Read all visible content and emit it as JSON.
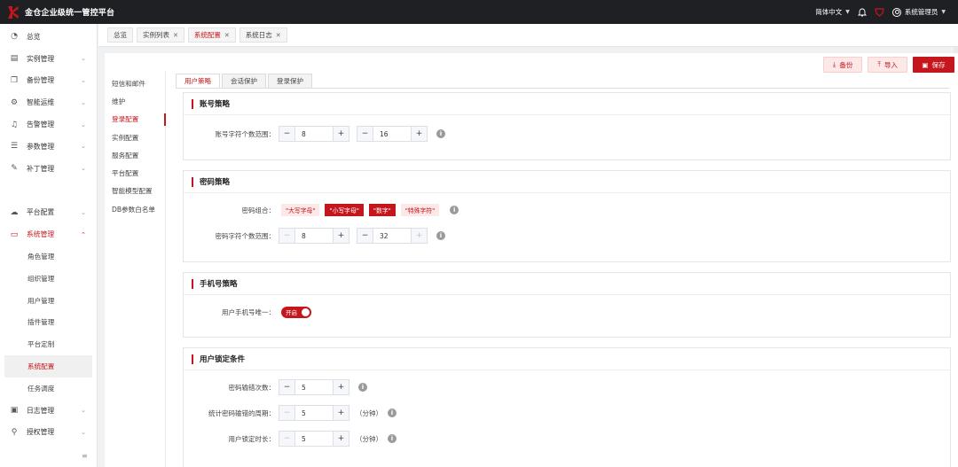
{
  "app": {
    "title": "金仓企业级统一管控平台"
  },
  "topbar": {
    "language": "简体中文",
    "user": "系统管理员"
  },
  "sidebar": {
    "items": [
      {
        "label": "总览",
        "icon": "dashboard-icon"
      },
      {
        "label": "实例管理",
        "icon": "list-icon"
      },
      {
        "label": "备份管理",
        "icon": "copy-icon"
      },
      {
        "label": "智能运维",
        "icon": "robot-icon"
      },
      {
        "label": "告警管理",
        "icon": "bell-icon"
      },
      {
        "label": "参数管理",
        "icon": "sliders-icon"
      },
      {
        "label": "补丁管理",
        "icon": "wrench-icon"
      }
    ],
    "items2": [
      {
        "label": "平台配置",
        "icon": "cloud-icon"
      },
      {
        "label": "系统管理",
        "icon": "monitor-icon"
      }
    ],
    "sub_items": [
      "角色管理",
      "组织管理",
      "用户管理",
      "插件管理",
      "平台定制",
      "系统配置",
      "任务调度"
    ],
    "items3": [
      {
        "label": "日志管理",
        "icon": "archive-icon"
      },
      {
        "label": "授权管理",
        "icon": "stamp-icon"
      }
    ],
    "collapse": "≡"
  },
  "page_tabs": [
    {
      "label": "总览"
    },
    {
      "label": "实例列表"
    },
    {
      "label": "系统配置"
    },
    {
      "label": "系统日志"
    }
  ],
  "actions": {
    "backup": "备份",
    "import": "导入",
    "save": "保存"
  },
  "subnav": [
    "短信和邮件",
    "维护",
    "登录配置",
    "实例配置",
    "服务配置",
    "平台配置",
    "智能模型配置",
    "DB参数白名单"
  ],
  "inner_tabs": [
    "用户策略",
    "会话保护",
    "登录保护"
  ],
  "sections": {
    "account": {
      "title": "账号策略",
      "char_range_label": "账号字符个数范围：",
      "min": "8",
      "max": "16"
    },
    "password": {
      "title": "密码策略",
      "combo_label": "密码组合：",
      "tags": [
        "\"大写字母\"",
        "\"小写字母\"",
        "\"数字\"",
        "\"特殊字符\""
      ],
      "char_range_label": "密码字符个数范围：",
      "min": "8",
      "max": "32"
    },
    "phone": {
      "title": "手机号策略",
      "unique_label": "用户手机号唯一：",
      "switch_text": "开启"
    },
    "lock": {
      "title": "用户锁定条件",
      "error_count_label": "密码输错次数：",
      "error_count": "5",
      "period_label": "统计密码输错的周期：",
      "period": "5",
      "duration_label": "用户锁定时长：",
      "duration": "5",
      "unit": "（分钟）"
    }
  },
  "colors": {
    "brand": "#c4161c",
    "topbar": "#1f2024"
  }
}
